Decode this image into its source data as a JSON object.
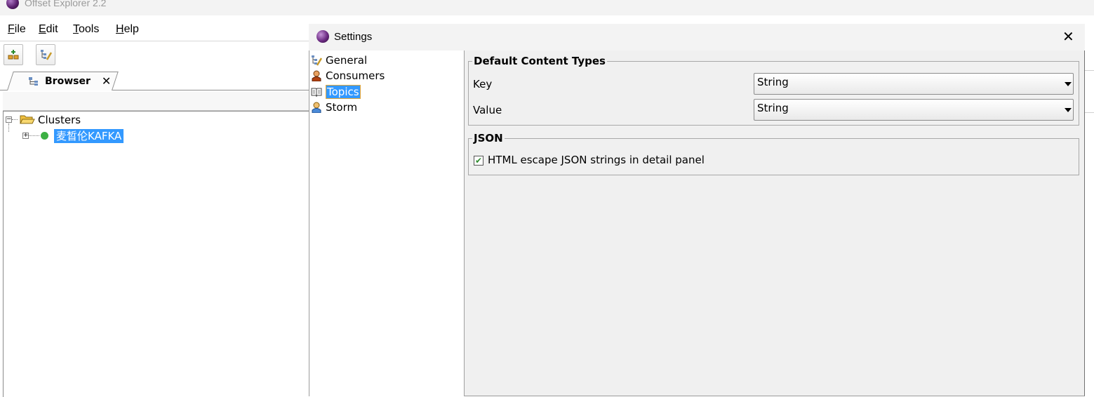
{
  "app": {
    "title": "Offset Explorer  2.2"
  },
  "menu": [
    {
      "label": "File",
      "mnemonic": "F",
      "rest": "ile"
    },
    {
      "label": "Edit",
      "mnemonic": "E",
      "rest": "dit"
    },
    {
      "label": "Tools",
      "mnemonic": "T",
      "rest": "ools"
    },
    {
      "label": "Help",
      "mnemonic": "H",
      "rest": "elp"
    }
  ],
  "browser_tab": {
    "label": "Browser",
    "close": "✕"
  },
  "tree": {
    "root": "Clusters",
    "cluster": "麦晳伦KAFKA",
    "root_expander": "−",
    "cluster_expander": "+"
  },
  "dialog": {
    "title": "Settings",
    "close": "✕",
    "nav": [
      {
        "label": "General",
        "icon": "general-settings-icon"
      },
      {
        "label": "Consumers",
        "icon": "consumer-person-icon"
      },
      {
        "label": "Topics",
        "icon": "book-icon",
        "selected": true
      },
      {
        "label": "Storm",
        "icon": "storm-person-icon"
      }
    ],
    "content_types": {
      "title": "Default Content Types",
      "key_label": "Key",
      "key_value": "String",
      "value_label": "Value",
      "value_value": "String"
    },
    "json": {
      "title": "JSON",
      "escape_label": "HTML escape JSON strings in detail panel",
      "escape_checked": true,
      "check_glyph": "✔"
    }
  },
  "colors": {
    "selection": "#3399ff",
    "selection_border": "#e5a537",
    "status_green": "#3cb043"
  }
}
